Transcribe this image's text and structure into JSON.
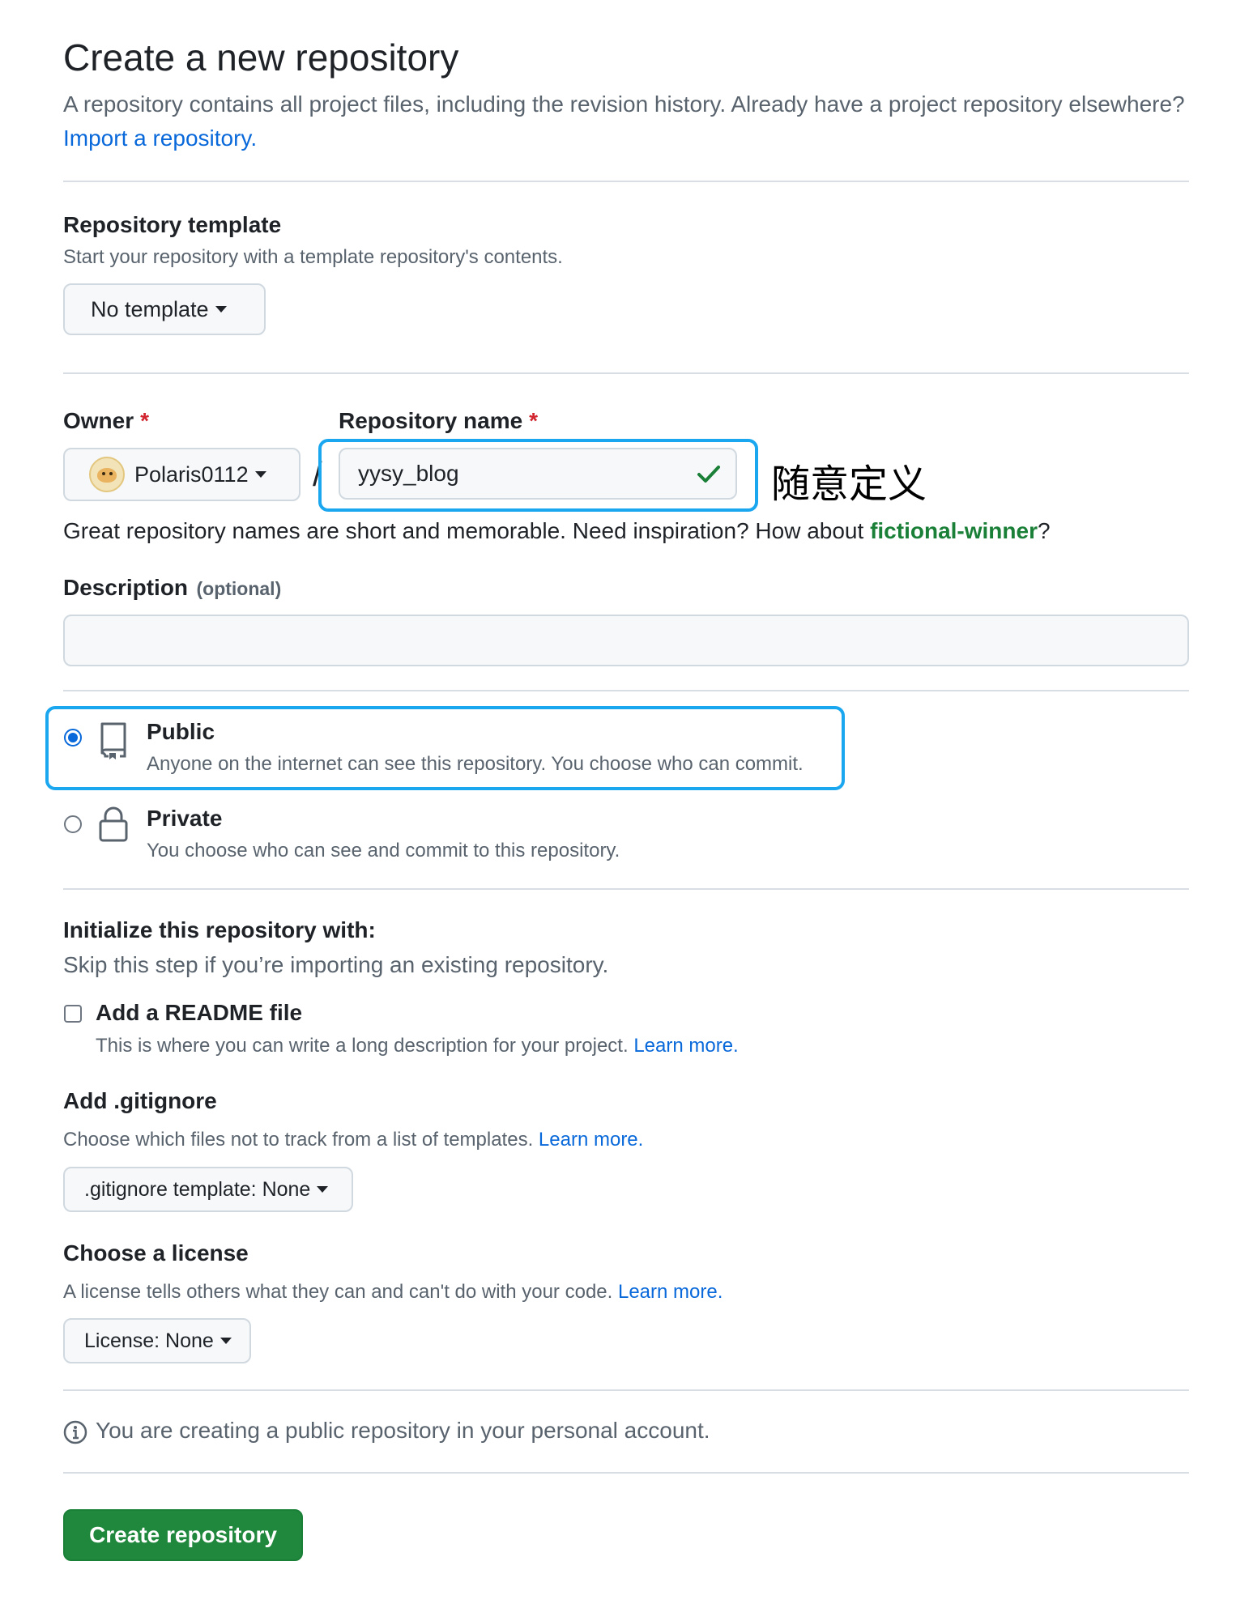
{
  "header": {
    "title": "Create a new repository",
    "intro_text": "A repository contains all project files, including the revision history. Already have a project repository elsewhere?",
    "import_link": "Import a repository."
  },
  "template": {
    "title": "Repository template",
    "description": "Start your repository with a template repository's contents.",
    "button_label": "No template"
  },
  "owner": {
    "label": "Owner",
    "required_mark": "*",
    "value": "Polaris0112"
  },
  "repo_name": {
    "label": "Repository name",
    "required_mark": "*",
    "separator": "/",
    "value": "yysy_blog",
    "hint_prefix": "Great repository names are short and memorable. Need inspiration? How about",
    "suggestion": "fictional-winner",
    "hint_suffix": "?",
    "annotation": "随意定义"
  },
  "description": {
    "label": "Description",
    "optional": "(optional)",
    "value": ""
  },
  "visibility": {
    "public": {
      "label": "Public",
      "description": "Anyone on the internet can see this repository. You choose who can commit.",
      "selected": true,
      "icon": "repo-icon"
    },
    "private": {
      "label": "Private",
      "description": "You choose who can see and commit to this repository.",
      "selected": false,
      "icon": "lock-icon"
    }
  },
  "initialize": {
    "title": "Initialize this repository with:",
    "subtitle": "Skip this step if you’re importing an existing repository.",
    "readme": {
      "label": "Add a README file",
      "description": "This is where you can write a long description for your project.",
      "learn_more": "Learn more.",
      "checked": false
    }
  },
  "gitignore": {
    "title": "Add .gitignore",
    "description": "Choose which files not to track from a list of templates.",
    "learn_more": "Learn more.",
    "button_label": ".gitignore template: None"
  },
  "license": {
    "title": "Choose a license",
    "description": "A license tells others what they can and can't do with your code.",
    "learn_more": "Learn more.",
    "button_label": "License: None"
  },
  "notice": {
    "text": "You are creating a public repository in your personal account."
  },
  "submit": {
    "label": "Create repository"
  },
  "colors": {
    "accent": "#0969da",
    "primary_button": "#1f883d",
    "highlight": "#1aa7ef",
    "required": "#d1242f",
    "suggestion": "#1a7f37"
  }
}
